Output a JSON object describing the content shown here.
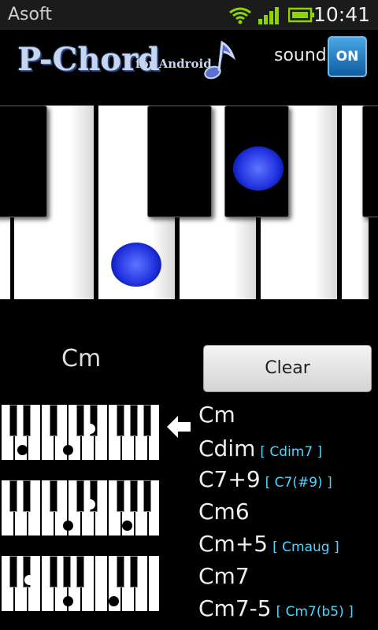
{
  "status_bar": {
    "carrier": "Asoft",
    "time": "10:41",
    "icons": [
      "wifi-icon",
      "signal-icon",
      "battery-icon"
    ]
  },
  "header": {
    "logo_main": "P-Chord",
    "logo_sub": "for Android",
    "sound_label": "sound",
    "sound_toggle": "ON"
  },
  "current_chord": "Cm",
  "clear_button": "Clear",
  "chords": [
    {
      "name": "Cm",
      "alt": ""
    },
    {
      "name": "Cdim",
      "alt": "[ Cdim7 ]"
    },
    {
      "name": "C7+9",
      "alt": "[ C7(#9) ]"
    },
    {
      "name": "Cm6",
      "alt": ""
    },
    {
      "name": "Cm+5",
      "alt": "[ Cmaug ]"
    },
    {
      "name": "Cm7",
      "alt": ""
    },
    {
      "name": "Cm7-5",
      "alt": "[ Cm7(b5) ]"
    }
  ],
  "colors": {
    "accent_blue": "#2535e0",
    "alt_text": "#4fd6ff",
    "toggle_on": "#0d5d9f"
  }
}
